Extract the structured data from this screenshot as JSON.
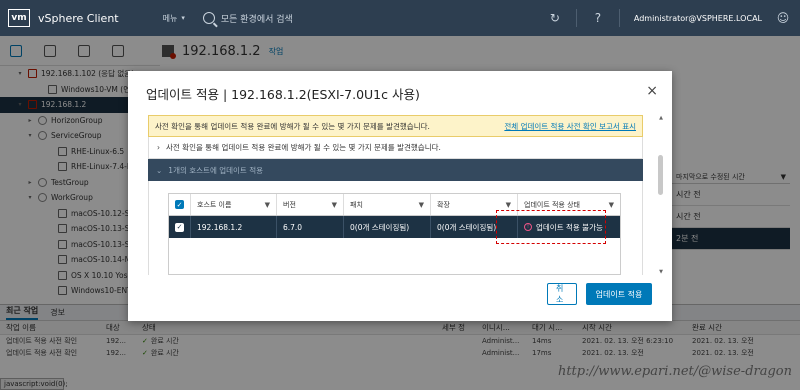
{
  "app": {
    "logo": "vm",
    "title": "vSphere Client",
    "menu_label": "메뉴",
    "search_placeholder": "모든 환경에서 검색",
    "user": "Administrator@VSPHERE.LOCAL",
    "icons": [
      "refresh-icon",
      "help-icon",
      "user-icon"
    ]
  },
  "content": {
    "title": "192.168.1.2",
    "actions_label": "작업"
  },
  "tree": [
    {
      "label": "192.168.1.102 (응답 없음)",
      "icon": "warn",
      "indent": 1,
      "caret": "v"
    },
    {
      "label": "Windows10-VM (연결 끊김)",
      "icon": "vm",
      "indent": 3,
      "caret": ""
    },
    {
      "label": "192.168.1.2",
      "icon": "warn",
      "indent": 1,
      "caret": "v",
      "selected": true
    },
    {
      "label": "HorizonGroup",
      "icon": "pool",
      "indent": 2,
      "caret": ">"
    },
    {
      "label": "ServiceGroup",
      "icon": "pool",
      "indent": 2,
      "caret": "v"
    },
    {
      "label": "RHE-Linux-6.5",
      "icon": "vm",
      "indent": 4,
      "caret": ""
    },
    {
      "label": "RHE-Linux-7.4-MS",
      "icon": "vm",
      "indent": 4,
      "caret": ""
    },
    {
      "label": "TestGroup",
      "icon": "pool",
      "indent": 2,
      "caret": ">"
    },
    {
      "label": "WorkGroup",
      "icon": "pool",
      "indent": 2,
      "caret": "v"
    },
    {
      "label": "macOS-10.12-Sier",
      "icon": "vm",
      "indent": 4,
      "caret": ""
    },
    {
      "label": "macOS-10.13-Sier",
      "icon": "vm",
      "indent": 4,
      "caret": ""
    },
    {
      "label": "macOS-10.13-Sier",
      "icon": "vm",
      "indent": 4,
      "caret": ""
    },
    {
      "label": "macOS-10.14-Moj",
      "icon": "vm",
      "indent": 4,
      "caret": ""
    },
    {
      "label": "OS X 10.10 Yosem",
      "icon": "vm",
      "indent": 4,
      "caret": ""
    },
    {
      "label": "Windows10-ENT-",
      "icon": "vm",
      "indent": 4,
      "caret": ""
    },
    {
      "label": "Windows10-ENT-",
      "icon": "vm",
      "indent": 4,
      "caret": ""
    }
  ],
  "right_panel": {
    "header": "마지막으로 수정된 시간",
    "rows": [
      "시간 전",
      "시간 전",
      "2분 전"
    ]
  },
  "bottom": {
    "tabs": [
      "최근 작업",
      "경보"
    ],
    "columns": [
      "작업 이름",
      "대상",
      "상태",
      "세부 정",
      "이니시...",
      "대기 시...",
      "시작 시간",
      "완료 시간"
    ],
    "rows": [
      [
        "업데이트 적용 사전 확인",
        "192...",
        "완료 시간",
        "",
        "Administ...",
        "14ms",
        "2021. 02. 13. 오전 6:23:10",
        "2021. 02. 13. 오전"
      ],
      [
        "업데이트 적용 사전 확인",
        "192...",
        "완료 시간",
        "",
        "Administ...",
        "17ms",
        "2021. 02. 13. 오전",
        "2021. 02. 13. 오전"
      ]
    ]
  },
  "statusbar": "javascript:void(0);",
  "watermark": "http://www.epari.net/@wise-dragon",
  "modal": {
    "title": "업데이트 적용 | 192.168.1.2(ESXI-7.0U1c 사용)",
    "close": "×",
    "warning": "사전 확인을 통해 업데이트 적용 완료에 방해가 될 수 있는 몇 가지 문제를 발견했습니다.",
    "warning_link": "전체 업데이트 적용 사전 확인 보고서 표시",
    "section1": "사전 확인을 통해 업데이트 적용 완료에 방해가 될 수 있는 몇 가지 문제를 발견했습니다.",
    "section2": "1개의 호스트에 업데이트 적용",
    "grid": {
      "columns": [
        "호스트 이름",
        "버전",
        "패치",
        "확장",
        "업데이트 적용 상태"
      ],
      "row": {
        "host": "192.168.1.2",
        "version": "6.7.0",
        "patch": "0(0개 스테이징됨)",
        "ext": "0(0개 스테이징됨)",
        "status": "업데이트 적용 불가능"
      }
    },
    "cancel": "취소",
    "apply": "업데이트 적용"
  }
}
